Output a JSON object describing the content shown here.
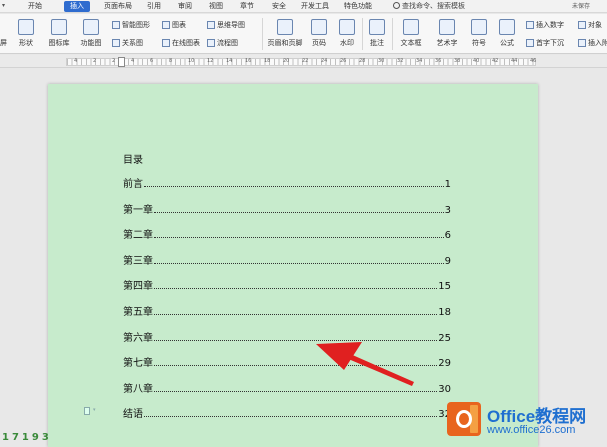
{
  "tabs": [
    "开始",
    "插入",
    "页面布局",
    "引用",
    "审阅",
    "视图",
    "章节",
    "安全",
    "开发工具",
    "特色功能"
  ],
  "active_tab": "插入",
  "search": "查找命令、搜索模板",
  "top_right": "未保存",
  "ribbon": {
    "left_cut": "屏",
    "shape": "形状",
    "icon_lib": "图标库",
    "func_chart": "功能图",
    "smart_shape": "智能图形",
    "relation": "关系图",
    "chart": "图表",
    "online_chart": "在线图表",
    "mind_map": "思维导图",
    "flow_chart": "流程图",
    "header_footer": "页眉和页脚",
    "page_num": "页码",
    "watermark": "水印",
    "comment": "批注",
    "textbox": "文本框",
    "art_text": "艺术字",
    "symbol": "符号",
    "formula": "公式",
    "insert_number": "插入数字",
    "object": "对象",
    "drop_cap": "首字下沉",
    "insert_attach": "插入附"
  },
  "ruler_nums": [
    "4",
    "2",
    "2",
    "4",
    "6",
    "8",
    "10",
    "12",
    "14",
    "16",
    "18",
    "20",
    "22",
    "24",
    "26",
    "28",
    "30",
    "32",
    "34",
    "36",
    "38",
    "40",
    "42",
    "44",
    "46"
  ],
  "toc": {
    "title": "目录",
    "rows": [
      {
        "label": "前言",
        "page": "1"
      },
      {
        "label": "第一章",
        "page": "3"
      },
      {
        "label": "第二章",
        "page": "6"
      },
      {
        "label": "第三章",
        "page": "9"
      },
      {
        "label": "第四章",
        "page": "15"
      },
      {
        "label": "第五章",
        "page": "18"
      },
      {
        "label": "第六章",
        "page": "25"
      },
      {
        "label": "第七章",
        "page": "29"
      },
      {
        "label": "第八章",
        "page": "30"
      },
      {
        "label": "结语",
        "page": "32"
      }
    ]
  },
  "status_nums": "17193",
  "watermark": {
    "title": "Office教程网",
    "url": "www.office26.com"
  },
  "colors": {
    "page_bg": "#c7ebcc",
    "active_tab": "#2f6ccf",
    "arrow": "#e02020",
    "watermark_blue": "#1f6fd0",
    "logo_orange": "#e8641e"
  }
}
